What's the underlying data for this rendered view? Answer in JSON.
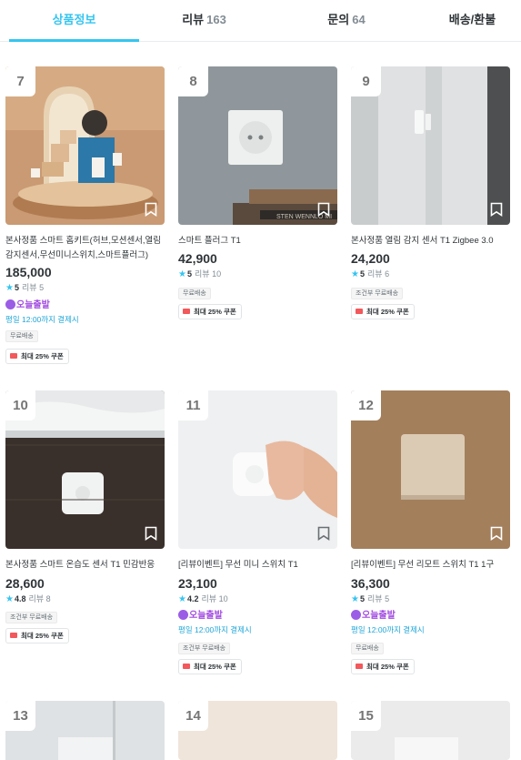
{
  "tabs": [
    {
      "label": "상품정보",
      "count": ""
    },
    {
      "label": "리뷰",
      "count": "163"
    },
    {
      "label": "문의",
      "count": "64"
    },
    {
      "label": "배송/환불",
      "count": ""
    }
  ],
  "products": [
    {
      "rank": "7",
      "title": "본사정품 스마트 홈키트(허브,모션센서,열림감지센서,무선미니스위치,스마트플러그)",
      "price": "185,000",
      "rating": "5",
      "review_label": "리뷰",
      "review_count": "5",
      "today_label": "오늘출발",
      "deadline": "평일 12:00까지 결제시",
      "badge": "무료배송",
      "coupon": "최대 25% 쿠폰",
      "colors": {
        "bg": "#c99a73"
      }
    },
    {
      "rank": "8",
      "title": "스마트 플러그 T1",
      "price": "42,900",
      "rating": "5",
      "review_label": "리뷰",
      "review_count": "10",
      "today_label": "",
      "deadline": "",
      "badge": "무료배송",
      "coupon": "최대 25% 쿠폰",
      "colors": {
        "bg": "#8e969b"
      }
    },
    {
      "rank": "9",
      "title": "본사정품 열림 감지 센서 T1 Zigbee 3.0",
      "price": "24,200",
      "rating": "5",
      "review_label": "리뷰",
      "review_count": "6",
      "today_label": "",
      "deadline": "",
      "badge": "조건부 무료배송",
      "coupon": "최대 25% 쿠폰",
      "colors": {
        "bg": "#d9dcdd"
      }
    },
    {
      "rank": "10",
      "title": "본사정품 스마트 온습도 센서 T1 민감반응",
      "price": "28,600",
      "rating": "4.8",
      "review_label": "리뷰",
      "review_count": "8",
      "today_label": "",
      "deadline": "",
      "badge": "조건부 무료배송",
      "coupon": "최대 25% 쿠폰",
      "colors": {
        "bg": "#3a2f2a"
      }
    },
    {
      "rank": "11",
      "title": "[리뷰이벤트] 무선 미니 스위치 T1",
      "price": "23,100",
      "rating": "4.2",
      "review_label": "리뷰",
      "review_count": "10",
      "today_label": "오늘출발",
      "deadline": "평일 12:00까지 결제시",
      "badge": "조건부 무료배송",
      "coupon": "최대 25% 쿠폰",
      "colors": {
        "bg": "#eef0f1"
      }
    },
    {
      "rank": "12",
      "title": "[리뷰이벤트] 무선 리모트 스위치 T1 1구",
      "price": "36,300",
      "rating": "5",
      "review_label": "리뷰",
      "review_count": "5",
      "today_label": "오늘출발",
      "deadline": "평일 12:00까지 결제시",
      "badge": "무료배송",
      "coupon": "최대 25% 쿠폰",
      "colors": {
        "bg": "#9f7b58"
      }
    },
    {
      "rank": "13"
    },
    {
      "rank": "14"
    },
    {
      "rank": "15"
    }
  ]
}
